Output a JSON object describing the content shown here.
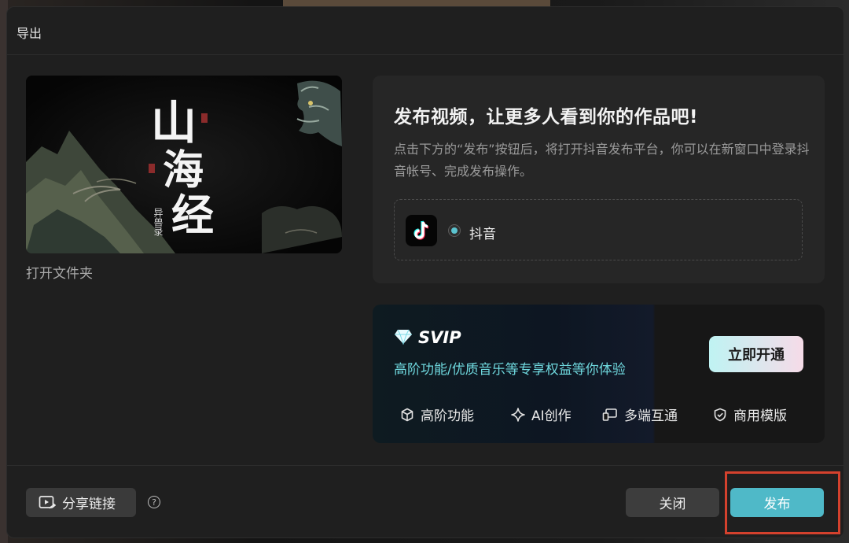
{
  "dialog": {
    "title": "导出"
  },
  "preview": {
    "open_folder": "打开文件夹",
    "thumbnail_title": "山海经",
    "thumbnail_subtitle": "异兽录"
  },
  "publish": {
    "heading": "发布视频，让更多人看到你的作品吧!",
    "description": "点击下方的“发布”按钮后，将打开抖音发布平台，你可以在新窗口中登录抖音帐号、完成发布操作。",
    "platform": {
      "label": "抖音",
      "icon": "tiktok-logo",
      "selected": true
    }
  },
  "svip": {
    "title": "SVIP",
    "subtitle": "高阶功能/优质音乐等专享权益等你体验",
    "cta": "立即开通",
    "features": [
      {
        "icon": "cube-icon",
        "label": "高阶功能"
      },
      {
        "icon": "sparkle-icon",
        "label": "AI创作"
      },
      {
        "icon": "devices-icon",
        "label": "多端互通"
      },
      {
        "icon": "shield-check-icon",
        "label": "商用模版"
      }
    ]
  },
  "footer": {
    "share": "分享链接",
    "close": "关闭",
    "publish": "发布"
  },
  "colors": {
    "accent": "#4fb9c8",
    "highlight": "#d4412d",
    "svip_text": "#6fd8de"
  }
}
